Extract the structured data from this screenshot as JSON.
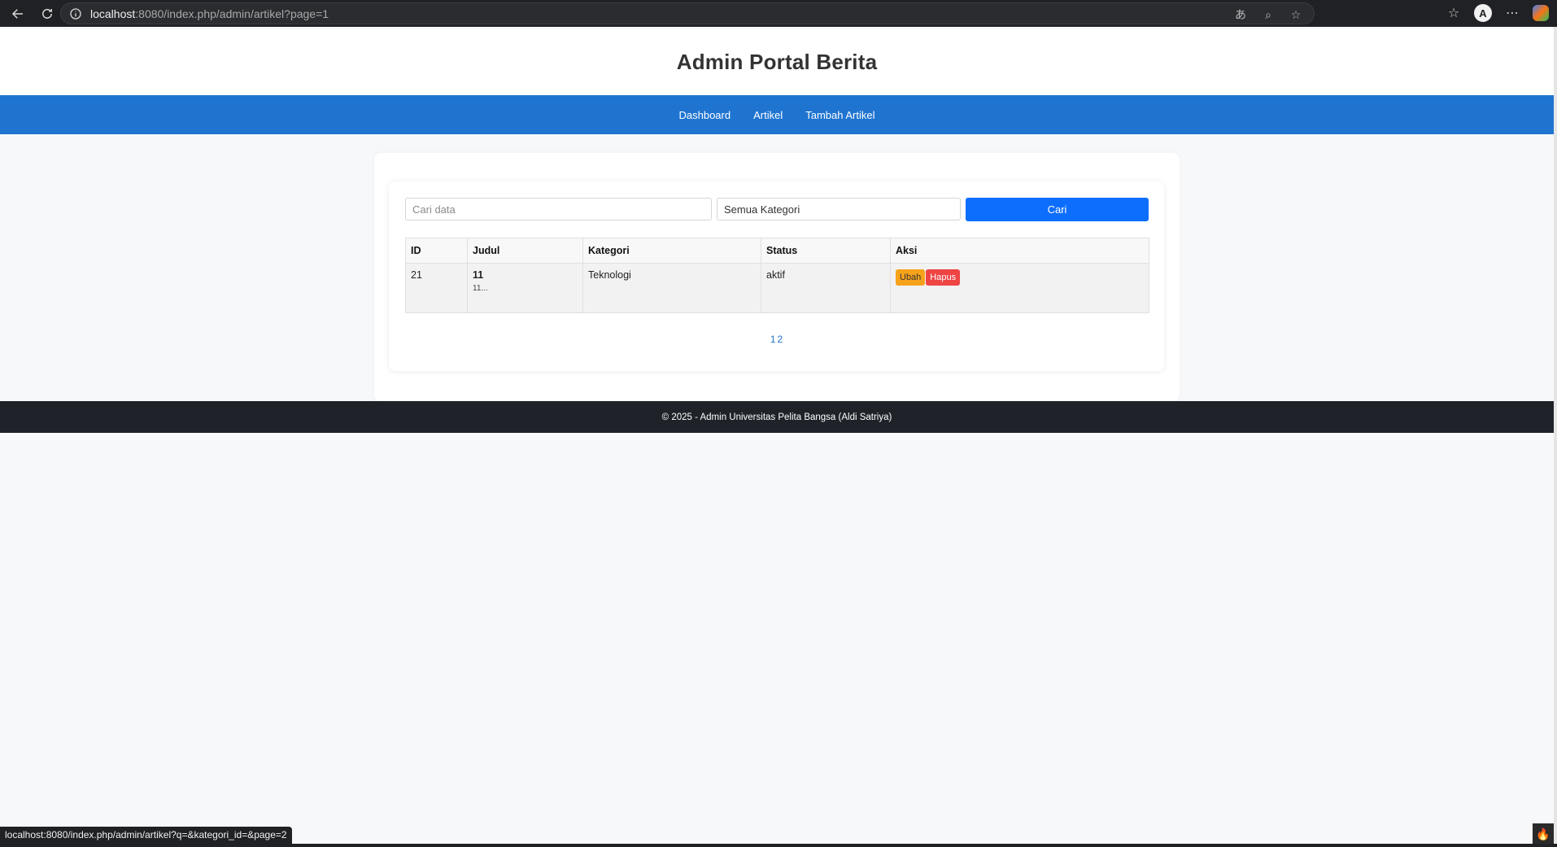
{
  "browser": {
    "url_host": "localhost",
    "url_rest": ":8080/index.php/admin/artikel?page=1",
    "status_link": "localhost:8080/index.php/admin/artikel?q=&kategori_id=&page=2",
    "icons": [
      "back-icon",
      "reload-icon",
      "info-icon",
      "translate-icon",
      "zoom-icon",
      "star-icon",
      "favorites-icon",
      "profile-icon",
      "more-icon",
      "copilot-icon"
    ]
  },
  "header": {
    "title": "Admin Portal Berita"
  },
  "nav": {
    "items": [
      {
        "label": "Dashboard"
      },
      {
        "label": "Artikel"
      },
      {
        "label": "Tambah Artikel"
      }
    ]
  },
  "filter": {
    "search_placeholder": "Cari data",
    "category_selected": "Semua Kategori",
    "search_button": "Cari"
  },
  "table": {
    "headers": [
      "ID",
      "Judul",
      "Kategori",
      "Status",
      "Aksi"
    ],
    "rows": [
      {
        "id": "21",
        "title": "11",
        "excerpt": "11...",
        "category": "Teknologi",
        "status": "aktif",
        "edit_label": "Ubah",
        "delete_label": "Hapus"
      }
    ]
  },
  "pagination": {
    "pages": [
      "1",
      "2"
    ]
  },
  "footer": {
    "text": "© 2025 - Admin Universitas Pelita Bangsa (Aldi Satriya)"
  },
  "colors": {
    "nav_bg": "#1f74d0",
    "primary_button": "#0d6efd",
    "edit_button": "#f7a21b",
    "delete_button": "#ef4444",
    "footer_bg": "#1f2329"
  }
}
